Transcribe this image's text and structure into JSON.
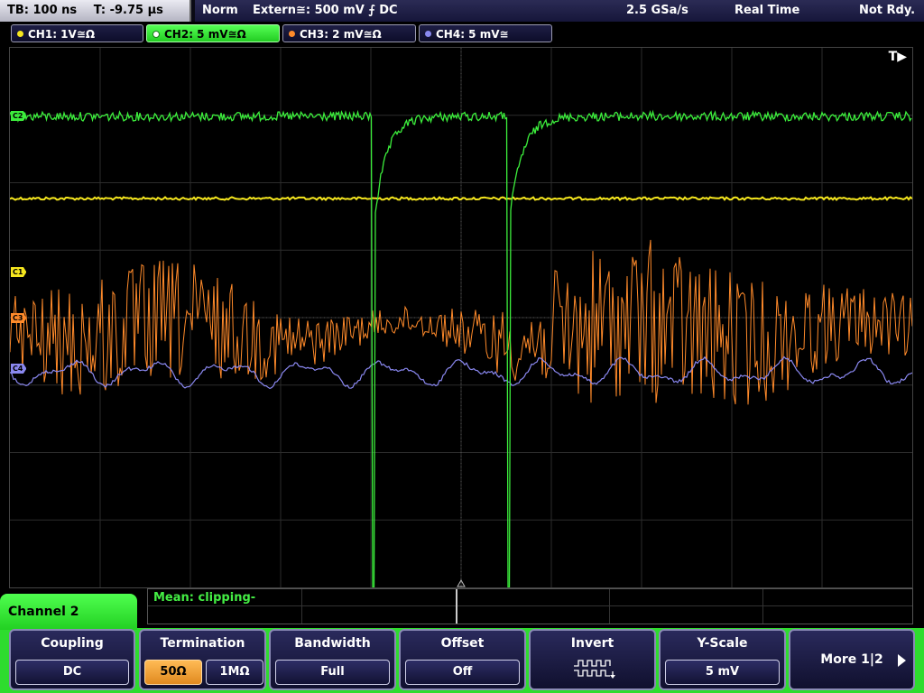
{
  "top_bar": {
    "timebase": "TB: 100 ns",
    "trigger_time": "T: -9.75 µs",
    "trigger_mode": "Norm",
    "trigger_source": "Extern≅: 500 mV ⨍ DC",
    "sample_rate": "2.5 GSa/s",
    "acq_mode": "Real Time",
    "acq_status": "Not Rdy."
  },
  "channels": [
    {
      "label": "CH1: 1V≅Ω",
      "color": "#f5e61e",
      "active": false
    },
    {
      "label": "CH2: 5 mV≅Ω",
      "color": "#3cee3c",
      "active": true
    },
    {
      "label": "CH3: 2 mV≅Ω",
      "color": "#ff8a2a",
      "active": false
    },
    {
      "label": "CH4: 5 mV≅",
      "color": "#8888ee",
      "active": false
    }
  ],
  "display": {
    "trigger_badge": "T▶",
    "markers": {
      "ch1": "C1",
      "ch2": "C2",
      "ch3": "C3",
      "ch4": "C4"
    }
  },
  "info_panel": {
    "mean_text": "Mean: clipping-"
  },
  "menu": {
    "title": "Channel 2",
    "softkeys": {
      "coupling": {
        "title": "Coupling",
        "value": "DC"
      },
      "termination": {
        "title": "Termination",
        "option_a": "50Ω",
        "option_b": "1MΩ",
        "selected": "50Ω"
      },
      "bandwidth": {
        "title": "Bandwidth",
        "value": "Full"
      },
      "offset": {
        "title": "Offset",
        "value": "Off"
      },
      "invert": {
        "title": "Invert",
        "icon": "invert-waveform-icon"
      },
      "yscale": {
        "title": "Y-Scale",
        "value": "5 mV"
      },
      "more": {
        "label": "More 1|2"
      }
    }
  }
}
